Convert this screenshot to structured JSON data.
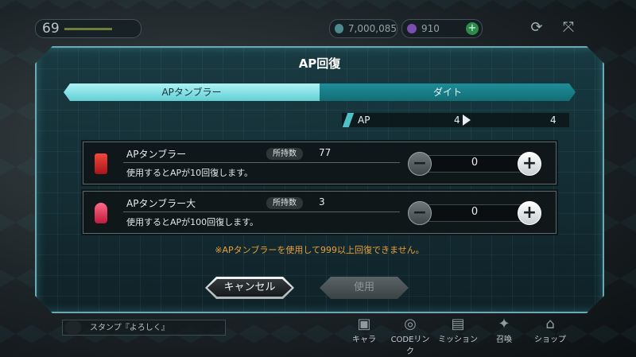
{
  "hud": {
    "level": "69",
    "coins": "7,000,085",
    "gems": "910"
  },
  "top_buttons": {
    "refresh_glyph": "⟳",
    "fullscreen_glyph": "⤧"
  },
  "dialog": {
    "title": "AP回復",
    "tabs": [
      {
        "label": "APタンブラー",
        "active": true
      },
      {
        "label": "ダイト",
        "active": false
      }
    ],
    "ap": {
      "label": "AP",
      "current": "4",
      "after": "4"
    },
    "items": [
      {
        "name": "APタンブラー",
        "owned_label": "所持数",
        "owned": "77",
        "description": "使用するとAPが10回復します。",
        "quantity": "0",
        "icon_color": "#d8282a"
      },
      {
        "name": "APタンブラー大",
        "owned_label": "所持数",
        "owned": "3",
        "description": "使用するとAPが100回復します。",
        "quantity": "0",
        "icon_color": "#e0355a"
      }
    ],
    "notice": "※APタンブラーを使用して999以上回復できません。",
    "cancel_label": "キャンセル",
    "use_label": "使用"
  },
  "bottom": {
    "stamp_text": "スタンプ『よろしく』",
    "nav": [
      "キャラ",
      "CODEリンク",
      "ミッション",
      "召喚",
      "ショップ"
    ]
  },
  "colors": {
    "accent": "#62cfd4",
    "notice": "#e8a03a"
  }
}
